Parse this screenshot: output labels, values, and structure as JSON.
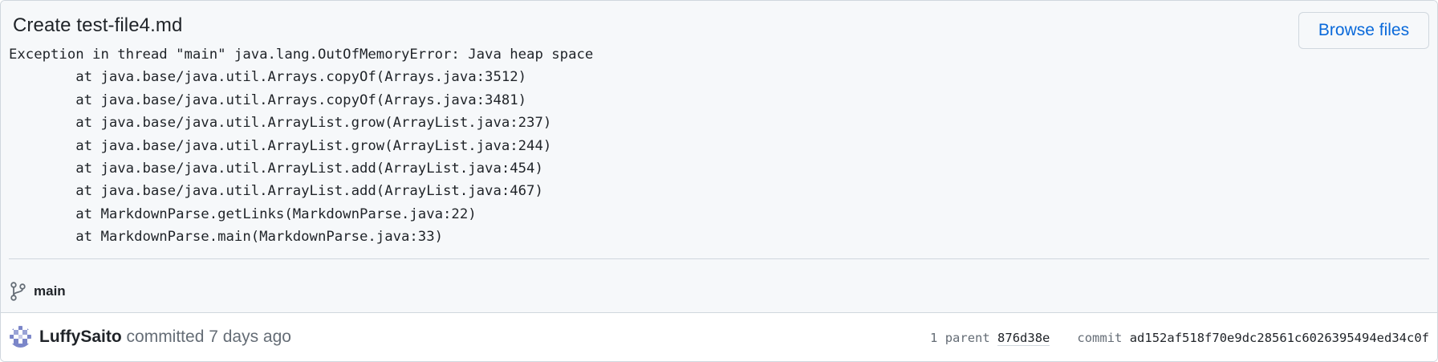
{
  "commit": {
    "title": "Create test-file4.md",
    "browse_files_label": "Browse files",
    "description_lines": [
      "Exception in thread \"main\" java.lang.OutOfMemoryError: Java heap space",
      "\tat java.base/java.util.Arrays.copyOf(Arrays.java:3512)",
      "\tat java.base/java.util.Arrays.copyOf(Arrays.java:3481)",
      "\tat java.base/java.util.ArrayList.grow(ArrayList.java:237)",
      "\tat java.base/java.util.ArrayList.grow(ArrayList.java:244)",
      "\tat java.base/java.util.ArrayList.add(ArrayList.java:454)",
      "\tat java.base/java.util.ArrayList.add(ArrayList.java:467)",
      "\tat MarkdownParse.getLinks(MarkdownParse.java:22)",
      "\tat MarkdownParse.main(MarkdownParse.java:33)"
    ],
    "branch": "main",
    "branch_icon": "git-branch-icon",
    "author": "LuffySaito",
    "committed_text": "committed",
    "relative_time": "7 days ago",
    "parent_count_label": "1 parent",
    "parent_sha": "876d38e",
    "commit_label": "commit",
    "commit_sha": "ad152af518f70e9dc28561c6026395494ed34c0f"
  },
  "colors": {
    "link": "#0969da",
    "header_bg": "#f6f8fa",
    "border": "#d0d7de",
    "muted_text": "#656d76",
    "avatar": "#7b86c9"
  }
}
